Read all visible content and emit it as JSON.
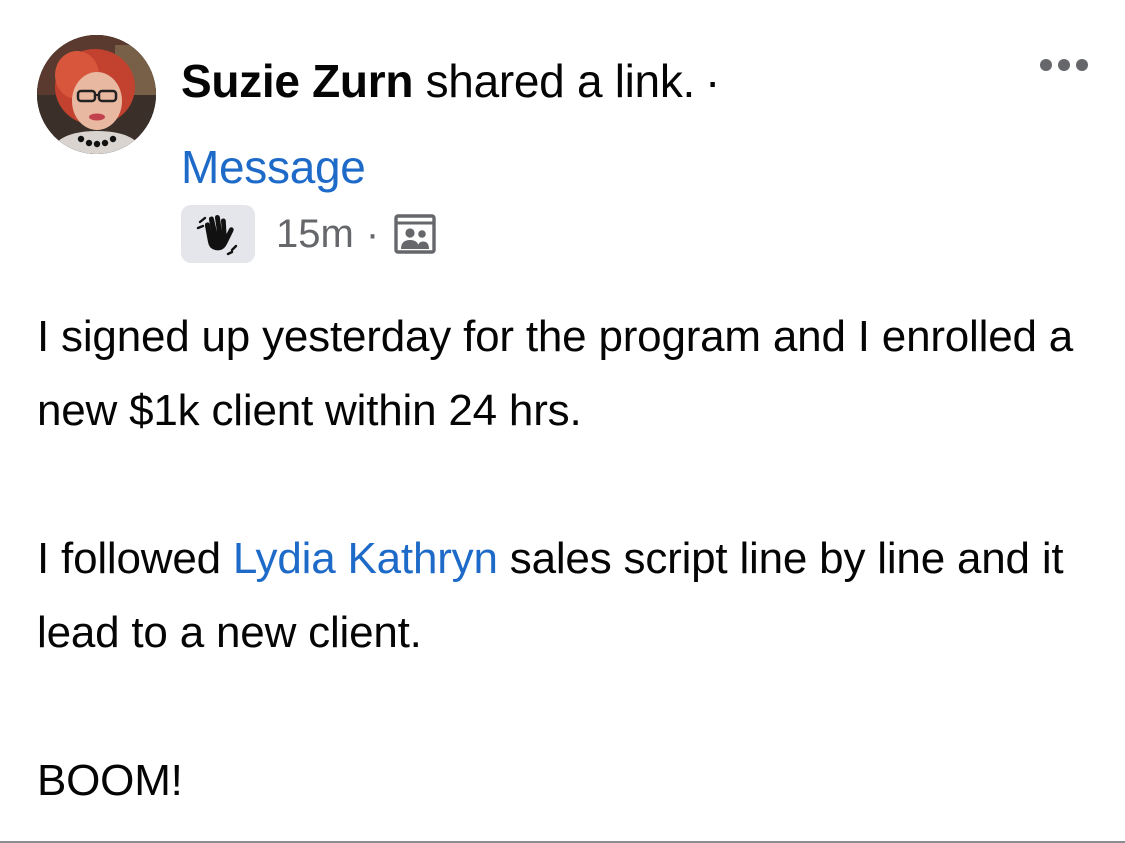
{
  "post": {
    "author_name": "Suzie Zurn",
    "action_text": "shared a link.",
    "separator": "·",
    "message_link": "Message",
    "time": "15m",
    "meta_separator": "·",
    "wave_badge_icon": "waving-hand-icon",
    "audience_icon": "group-audience-icon",
    "more_icon": "more-options-icon",
    "paragraphs": [
      {
        "text": "I signed up yesterday for the program and I enrolled a new $1k client within 24 hrs."
      },
      {
        "before": "I followed ",
        "mention": "Lydia Kathryn",
        "after": " sales script line by line and it lead to a new client."
      },
      {
        "text": "BOOM!"
      }
    ]
  },
  "colors": {
    "link_blue": "#1d6ac8",
    "text": "#050505",
    "secondary": "#65676b",
    "badge_bg": "#e4e6eb"
  }
}
